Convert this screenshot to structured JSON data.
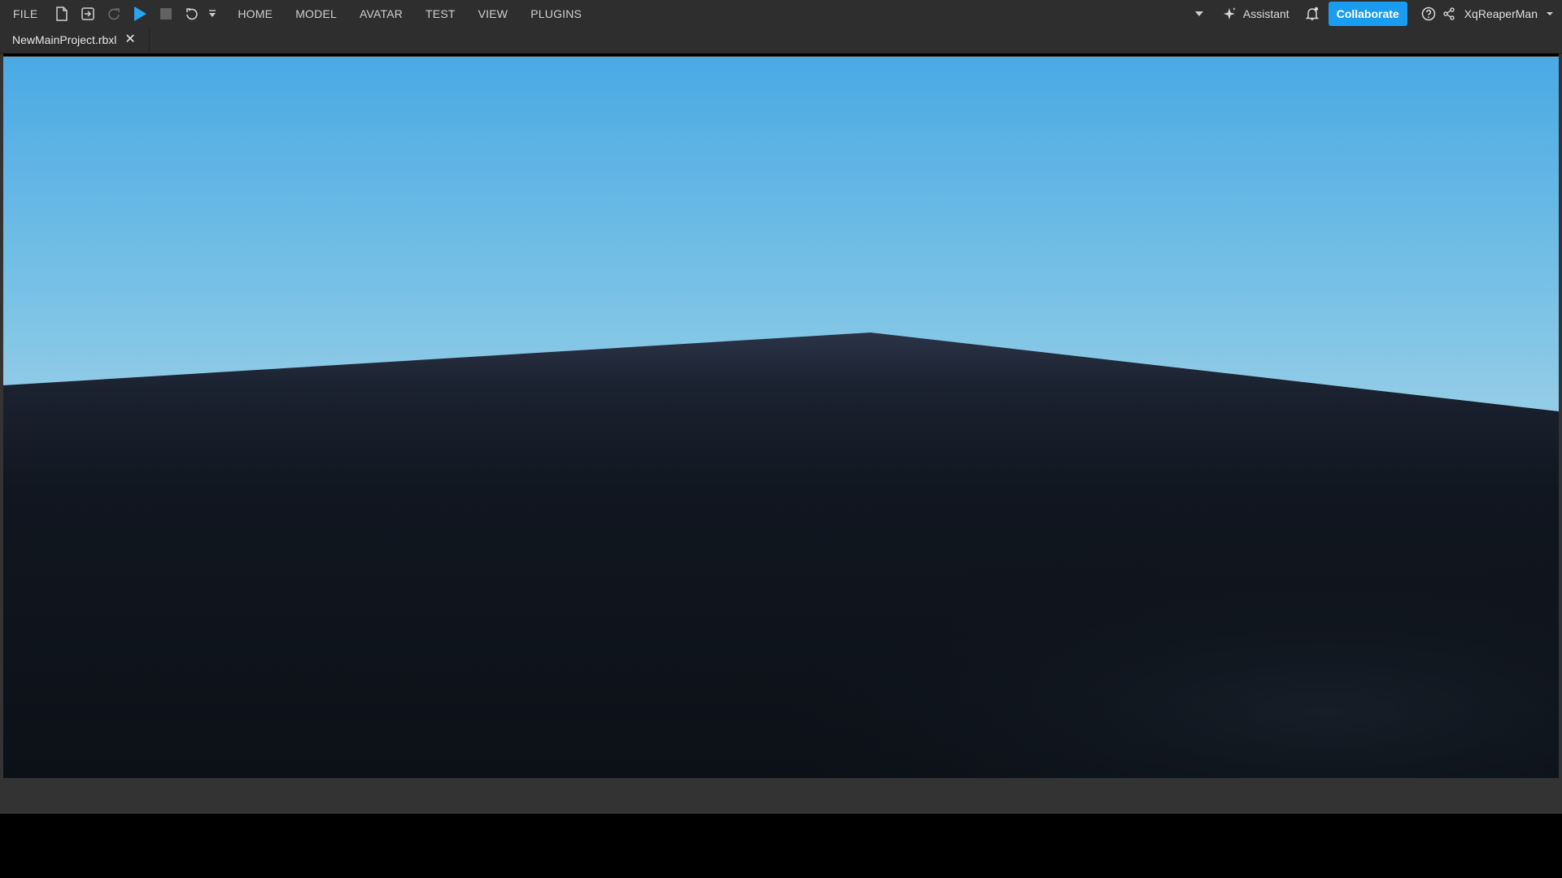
{
  "menubar": {
    "items": [
      {
        "label": "FILE"
      },
      {
        "label": "HOME"
      },
      {
        "label": "MODEL"
      },
      {
        "label": "AVATAR"
      },
      {
        "label": "TEST"
      },
      {
        "label": "VIEW"
      },
      {
        "label": "PLUGINS"
      }
    ],
    "toolbar_icons": [
      "new-file-icon",
      "open-file-icon",
      "redo-icon",
      "play-icon",
      "stop-icon",
      "undo-icon",
      "quick-access-dropdown-icon"
    ],
    "assistant_label": "Assistant",
    "collaborate_label": "Collaborate",
    "username": "XqReaperMan"
  },
  "tabs": [
    {
      "label": "NewMainProject.rbxl"
    }
  ],
  "colors": {
    "menubar_bg": "#2e2e2e",
    "accent_blue": "#1a9cf0",
    "play_blue": "#27a4f2",
    "sky_top": "#4aa9e4",
    "sky_horizon": "#dde3e6",
    "ground": "#0f141b"
  }
}
